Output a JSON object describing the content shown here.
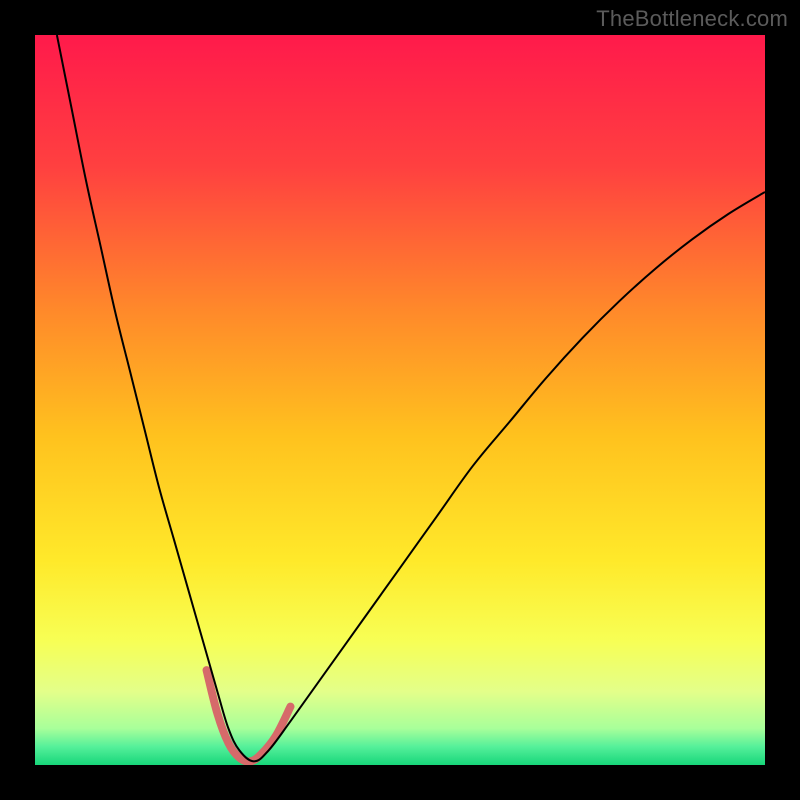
{
  "watermark": "TheBottleneck.com",
  "chart_data": {
    "type": "line",
    "title": "",
    "xlabel": "",
    "ylabel": "",
    "xlim": [
      0,
      100
    ],
    "ylim": [
      0,
      100
    ],
    "grid": false,
    "legend": false,
    "annotations": [],
    "background_gradient_stops": [
      {
        "offset": 0.0,
        "color": "#ff1a4b"
      },
      {
        "offset": 0.18,
        "color": "#ff4040"
      },
      {
        "offset": 0.38,
        "color": "#ff8a2a"
      },
      {
        "offset": 0.55,
        "color": "#ffc21e"
      },
      {
        "offset": 0.72,
        "color": "#ffe92a"
      },
      {
        "offset": 0.83,
        "color": "#f7ff55"
      },
      {
        "offset": 0.9,
        "color": "#e3ff8a"
      },
      {
        "offset": 0.95,
        "color": "#a8ff9a"
      },
      {
        "offset": 0.975,
        "color": "#55f09a"
      },
      {
        "offset": 1.0,
        "color": "#17d67a"
      }
    ],
    "series": [
      {
        "name": "bottleneck-curve",
        "color": "#000000",
        "width": 2,
        "x": [
          3,
          5,
          7,
          9,
          11,
          13,
          15,
          17,
          19,
          21,
          23,
          25,
          26.5,
          28,
          30,
          32,
          35,
          40,
          45,
          50,
          55,
          60,
          65,
          70,
          75,
          80,
          85,
          90,
          95,
          100
        ],
        "y": [
          100,
          90,
          80,
          71,
          62,
          54,
          46,
          38,
          31,
          24,
          17,
          10,
          5,
          2,
          0.5,
          2,
          6,
          13,
          20,
          27,
          34,
          41,
          47,
          53,
          58.5,
          63.5,
          68,
          72,
          75.5,
          78.5
        ]
      },
      {
        "name": "bottom-highlight",
        "color": "#d66a6a",
        "width": 8,
        "linecap": "round",
        "x": [
          23.5,
          25,
          26.5,
          28,
          29.5,
          31,
          33,
          35
        ],
        "y": [
          13,
          7,
          3,
          1,
          0.5,
          1.5,
          4,
          8
        ]
      }
    ]
  }
}
